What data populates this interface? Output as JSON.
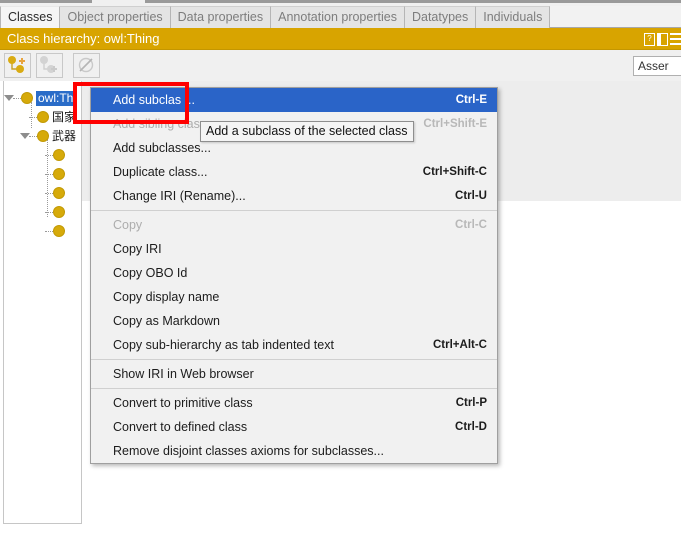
{
  "window": {
    "tabs": [
      {
        "label": "Classes",
        "active": true
      },
      {
        "label": "Object properties",
        "active": false
      },
      {
        "label": "Data properties",
        "active": false
      },
      {
        "label": "Annotation properties",
        "active": false
      },
      {
        "label": "Datatypes",
        "active": false
      },
      {
        "label": "Individuals",
        "active": false
      }
    ]
  },
  "titlebar": {
    "title": "Class hierarchy: owl:Thing",
    "icons": [
      {
        "name": "help-icon",
        "glyph": "?"
      },
      {
        "name": "split-view-icon",
        "glyph": ""
      },
      {
        "name": "menu-icon",
        "glyph": ""
      }
    ],
    "background_color": "#d8a400"
  },
  "toolbar": {
    "buttons": [
      {
        "name": "add-subclass-button",
        "icon": "add-subclass-icon",
        "enabled": true
      },
      {
        "name": "add-sibling-class-button",
        "icon": "add-sibling-class-icon",
        "enabled": false
      },
      {
        "name": "delete-class-button",
        "icon": "delete-class-icon",
        "enabled": false
      }
    ],
    "view_selector": {
      "value": "Asser",
      "placeholder": "Asserted"
    }
  },
  "tree": {
    "nodes": [
      {
        "label": "owl:Th",
        "selected": true,
        "depth": 0,
        "expanded": true,
        "has_children": true
      },
      {
        "label": "国家",
        "selected": false,
        "depth": 1,
        "expanded": false,
        "has_children": false
      },
      {
        "label": "武器",
        "selected": false,
        "depth": 1,
        "expanded": true,
        "has_children": true
      },
      {
        "label": "",
        "selected": false,
        "depth": 2,
        "expanded": false,
        "has_children": false
      },
      {
        "label": "",
        "selected": false,
        "depth": 2,
        "expanded": false,
        "has_children": false
      },
      {
        "label": "",
        "selected": false,
        "depth": 2,
        "expanded": false,
        "has_children": false
      },
      {
        "label": "",
        "selected": false,
        "depth": 2,
        "expanded": false,
        "has_children": false
      },
      {
        "label": "",
        "selected": false,
        "depth": 2,
        "expanded": false,
        "has_children": false
      }
    ]
  },
  "context_menu": {
    "items": [
      {
        "label": "Add subclas ...",
        "accelerator": "Ctrl-E",
        "state": "selected",
        "name": "menu-add-subclass"
      },
      {
        "label": "Add sibling clas",
        "accelerator": "Ctrl+Shift-E",
        "state": "disabled",
        "name": "menu-add-sibling-class"
      },
      {
        "label": "Add subclasses...",
        "accelerator": "",
        "state": "normal",
        "name": "menu-add-subclasses"
      },
      {
        "label": "Duplicate class...",
        "accelerator": "Ctrl+Shift-C",
        "state": "normal",
        "name": "menu-duplicate-class"
      },
      {
        "label": "Change IRI (Rename)...",
        "accelerator": "Ctrl-U",
        "state": "normal",
        "name": "menu-change-iri"
      },
      {
        "separator": true
      },
      {
        "label": "Copy",
        "accelerator": "Ctrl-C",
        "state": "disabled",
        "name": "menu-copy"
      },
      {
        "label": "Copy IRI",
        "accelerator": "",
        "state": "normal",
        "name": "menu-copy-iri"
      },
      {
        "label": "Copy OBO Id",
        "accelerator": "",
        "state": "normal",
        "name": "menu-copy-obo-id"
      },
      {
        "label": "Copy display name",
        "accelerator": "",
        "state": "normal",
        "name": "menu-copy-display-name"
      },
      {
        "label": "Copy as Markdown",
        "accelerator": "",
        "state": "normal",
        "name": "menu-copy-as-markdown"
      },
      {
        "label": "Copy sub-hierarchy as tab indented text",
        "accelerator": "Ctrl+Alt-C",
        "state": "normal",
        "name": "menu-copy-sub-hierarchy"
      },
      {
        "separator": true
      },
      {
        "label": "Show IRI in Web browser",
        "accelerator": "",
        "state": "normal",
        "name": "menu-show-iri-in-web-browser"
      },
      {
        "separator": true
      },
      {
        "label": "Convert to primitive class",
        "accelerator": "Ctrl-P",
        "state": "normal",
        "name": "menu-convert-to-primitive-class"
      },
      {
        "label": "Convert to defined class",
        "accelerator": "Ctrl-D",
        "state": "normal",
        "name": "menu-convert-to-defined-class"
      },
      {
        "label": "Remove disjoint classes axioms for subclasses...",
        "accelerator": "",
        "state": "normal",
        "name": "menu-remove-disjoint-classes-axioms"
      }
    ]
  },
  "tooltip": {
    "text": "Add a subclass of the selected class"
  },
  "annotation": {
    "color": "#ff0000",
    "shape": "rectangle"
  }
}
